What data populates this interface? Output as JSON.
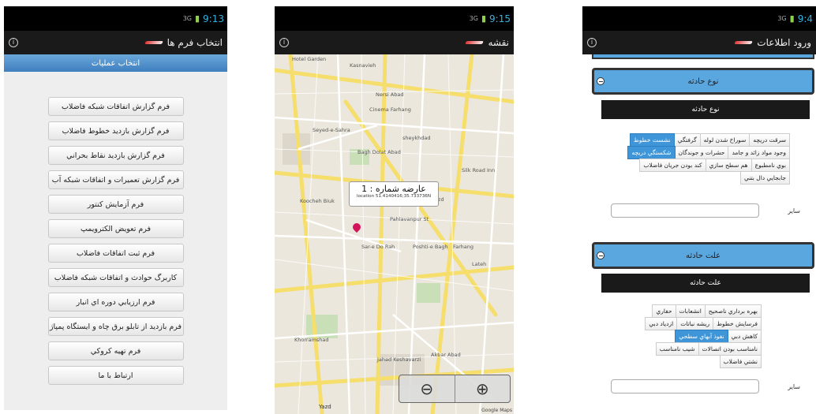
{
  "status": {
    "sim": "3G",
    "times": [
      "9:13",
      "9:15",
      "9:4"
    ]
  },
  "screen1": {
    "title": "انتخاب فرم ها",
    "subheader": "انتخاب عملیات",
    "menu": [
      "فرم گزارش اتفاقات شبکه فاضلاب",
      "فرم گزارش بازدید خطوط فاضلاب",
      "فرم گزارش بازدید نقاط بحراني",
      "فرم گزارش تعميرات و اتفاقات شبکه آب",
      "فرم آزمايش كنتور",
      "فرم تعويض الكترويمپ",
      "فرم ثبت اتفاقات فاضلاب",
      "كاربرگ حوادث و اتفاقات شبكه فاضلاب",
      "فرم ارزيابي دوره اي انبار",
      "فرم بازديد از تابلو برق چاه و ايستگاه پمپاژ",
      "فرم تهيه كروكي",
      "ارتباط با ما"
    ]
  },
  "screen2": {
    "title": "نقشه",
    "popup_title": "عارضه شماره : 1",
    "popup_location": "location 51.4140416;35.733736N",
    "labels": [
      "Hotel Garden",
      "Kasnavieh",
      "Nersi Abad",
      "Cinema Farhang",
      "Seyed-e-Sahra",
      "sheykhdad",
      "Bagh Dolat Abad",
      "Silk Road Inn",
      "Koocheh Biuk",
      "Yazd",
      "Sar-e Do Rah",
      "Poshti-e Bagh",
      "Farhang",
      "Lateh",
      "Khorramshad",
      "Jahad Keshavarzi",
      "Akbar Abad",
      "Pahlavanpur St",
      "Yazd"
    ],
    "google": "Google Maps"
  },
  "screen3": {
    "title": "ورود اطلاعات",
    "section1": "نوع حادثه",
    "bar1": "نوع حادثه",
    "chips1": [
      {
        "label": "سرقت دريچه",
        "on": false
      },
      {
        "label": "سوراخ شدن لوله",
        "on": false
      },
      {
        "label": "گرفتگي",
        "on": false
      },
      {
        "label": "نشست خطوط",
        "on": true
      },
      {
        "label": "وجود مواد زائد و جامد",
        "on": false
      },
      {
        "label": "حشرات و جوندگان",
        "on": false
      },
      {
        "label": "شكستگي دريچه",
        "on": true
      },
      {
        "label": "بوي نامطبوع",
        "on": false
      },
      {
        "label": "هم سطح سازي",
        "on": false
      },
      {
        "label": "کند بودن جريان فاضلاب",
        "on": false
      },
      {
        "label": "جابجايي دال بتني",
        "on": false
      }
    ],
    "other1": "ساير",
    "section2": "علت حادثه",
    "bar2": "علت حادثه",
    "chips2": [
      {
        "label": "بهره برداري ناصحيح",
        "on": false
      },
      {
        "label": "انشعابات",
        "on": false
      },
      {
        "label": "حفاري",
        "on": false
      },
      {
        "label": "فرسايش خطوط",
        "on": false
      },
      {
        "label": "ريشه نباتات",
        "on": false
      },
      {
        "label": "ازدياد دبي",
        "on": false
      },
      {
        "label": "كاهش دبي",
        "on": false
      },
      {
        "label": "نفوذ آبهاي سطحي",
        "on": true
      },
      {
        "label": "نامناسب بودن اتصالات",
        "on": false
      },
      {
        "label": "شيب نامناسب",
        "on": false
      },
      {
        "label": "نشتي فاضلاب",
        "on": false
      }
    ],
    "other2": "ساير"
  }
}
